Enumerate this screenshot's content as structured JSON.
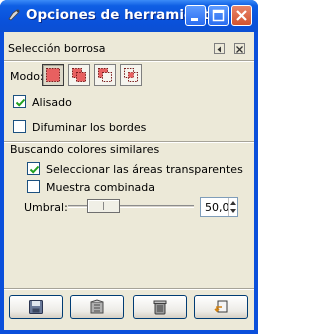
{
  "window": {
    "title": "Opciones de herramienta"
  },
  "dock": {
    "title": "Selección borrosa"
  },
  "mode": {
    "label": "Modo:",
    "options": [
      "replace",
      "add",
      "subtract",
      "intersect"
    ],
    "selected": "replace"
  },
  "options": {
    "antialias": {
      "label": "Alisado",
      "checked": true
    },
    "feather": {
      "label": "Difuminar los bordes",
      "checked": false
    }
  },
  "similar": {
    "title": "Buscando colores similares",
    "transparent": {
      "label": "Seleccionar las áreas transparentes",
      "checked": true
    },
    "merged": {
      "label": "Muestra combinada",
      "checked": false
    },
    "threshold": {
      "label": "Umbral:",
      "value": "50,0",
      "fraction": 0.2
    }
  },
  "buttons": [
    "save-icon",
    "restore-icon",
    "delete-icon",
    "reset-icon"
  ],
  "colors": {
    "titlebar": "#0a52dc",
    "client": "#ece9d8",
    "close": "#d2532e"
  }
}
